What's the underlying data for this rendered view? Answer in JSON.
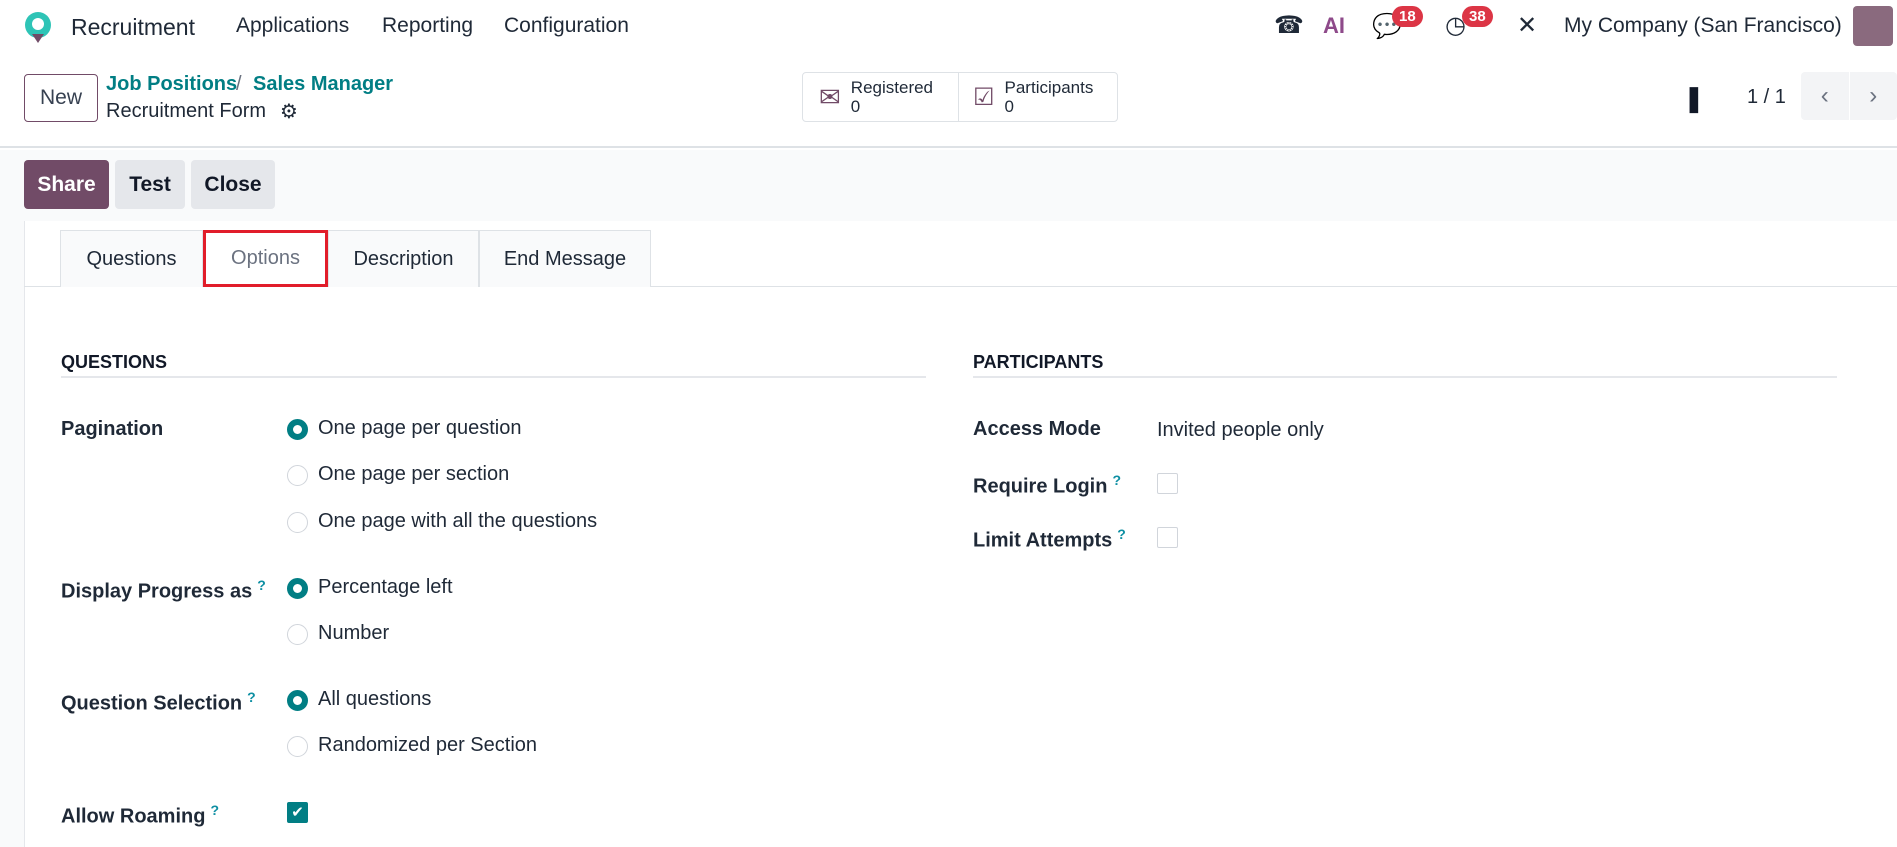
{
  "nav": {
    "app": "Recruitment",
    "menus": [
      "Applications",
      "Reporting",
      "Configuration"
    ],
    "messages_count": "18",
    "activities_count": "38",
    "company": "My Company (San Francisco)"
  },
  "control": {
    "new": "New",
    "breadcrumb": [
      "Job Positions",
      "Sales Manager"
    ],
    "record": "Recruitment Form",
    "stats": [
      {
        "label": "Registered",
        "value": "0"
      },
      {
        "label": "Participants",
        "value": "0"
      }
    ],
    "pager": "1 / 1"
  },
  "actions": {
    "share": "Share",
    "test": "Test",
    "close": "Close"
  },
  "tabs": [
    "Questions",
    "Options",
    "Description",
    "End Message"
  ],
  "active_tab": "Options",
  "questions": {
    "title": "QUESTIONS",
    "pagination": {
      "label": "Pagination",
      "options": [
        "One page per question",
        "One page per section",
        "One page with all the questions"
      ],
      "selected": "One page per question"
    },
    "progress": {
      "label": "Display Progress as",
      "options": [
        "Percentage left",
        "Number"
      ],
      "selected": "Percentage left"
    },
    "selection": {
      "label": "Question Selection",
      "options": [
        "All questions",
        "Randomized per Section"
      ],
      "selected": "All questions"
    },
    "roaming": {
      "label": "Allow Roaming",
      "checked": true
    },
    "help": "?"
  },
  "participants": {
    "title": "PARTICIPANTS",
    "access_label": "Access Mode",
    "access_value": "Invited people only",
    "login_label": "Require Login",
    "login_checked": false,
    "attempts_label": "Limit Attempts",
    "attempts_checked": false
  },
  "colors": {
    "primary": "#714b67",
    "teal": "#017e84",
    "link": "#017e84",
    "badge": "#dc3545",
    "highlight": "#e11d2a"
  }
}
